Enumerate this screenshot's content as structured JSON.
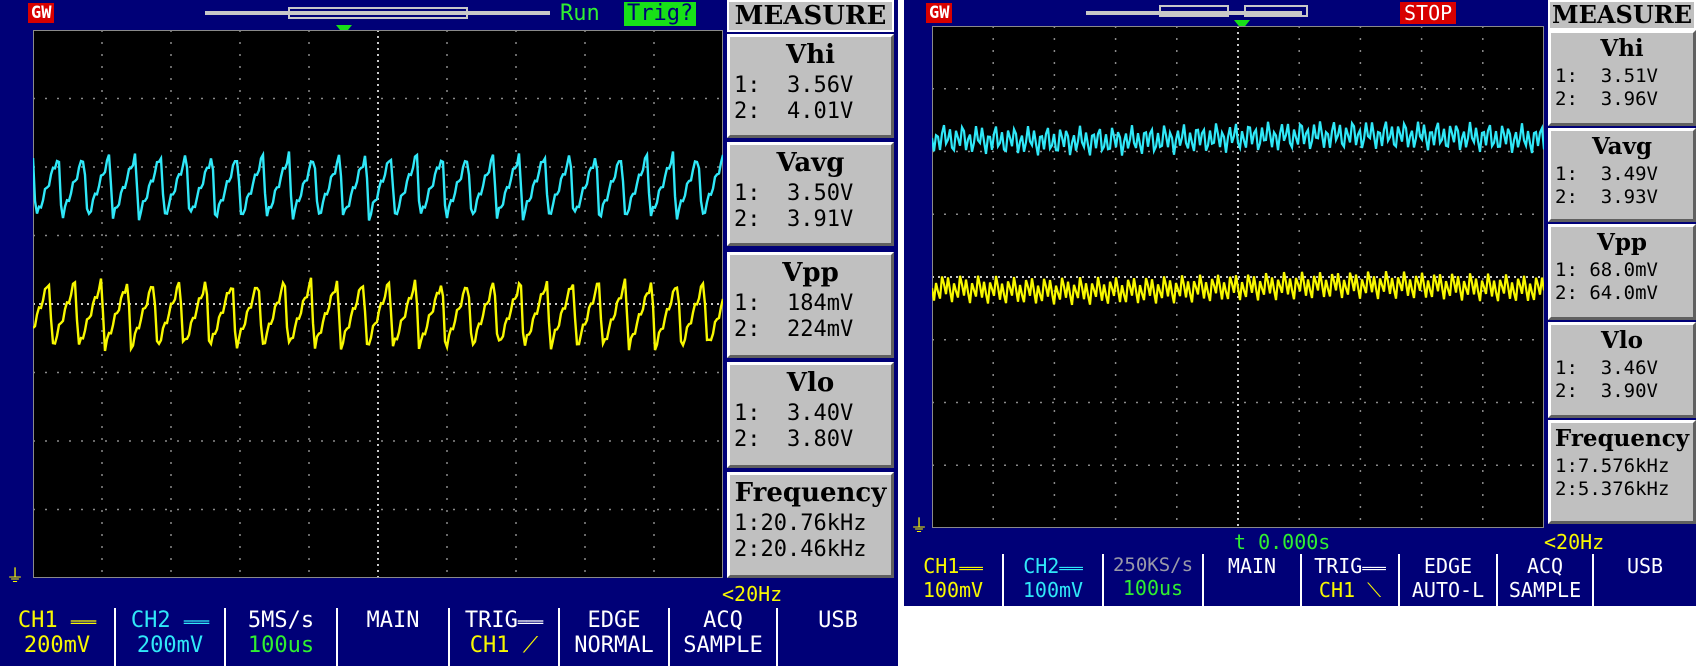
{
  "left_scope": {
    "badge": "GW",
    "run_label": "Run",
    "trig_status": "Trig?",
    "measure_title": "MEASURE",
    "measurements": [
      {
        "name": "Vhi",
        "ch1": "1:  3.56V",
        "ch2": "2:  4.01V"
      },
      {
        "name": "Vavg",
        "ch1": "1:  3.50V",
        "ch2": "2:  3.91V"
      },
      {
        "name": "Vpp",
        "ch1": "1:  184mV",
        "ch2": "2:  224mV"
      },
      {
        "name": "Vlo",
        "ch1": "1:  3.40V",
        "ch2": "2:  3.80V"
      },
      {
        "name": "Frequency",
        "ch1": "1:20.76kHz",
        "ch2": "2:20.46kHz"
      }
    ],
    "freq_status": "<20Hz",
    "bottom": {
      "ch1": {
        "label": "CH1",
        "value": "200mV"
      },
      "ch2": {
        "label": "CH2",
        "value": "200mV"
      },
      "rate": {
        "label": "5MS/s",
        "value": "100us"
      },
      "main": "MAIN",
      "trig": {
        "label": "TRIG",
        "value": "CH1"
      },
      "edge": {
        "label": "EDGE",
        "value": "NORMAL"
      },
      "acq": {
        "label": "ACQ",
        "value": "SAMPLE"
      },
      "usb": "USB"
    }
  },
  "right_scope": {
    "badge": "GW",
    "stop_label": "STOP",
    "measure_title": "MEASURE",
    "measurements": [
      {
        "name": "Vhi",
        "ch1": "1:  3.51V",
        "ch2": "2:  3.96V"
      },
      {
        "name": "Vavg",
        "ch1": "1:  3.49V",
        "ch2": "2:  3.93V"
      },
      {
        "name": "Vpp",
        "ch1": "1: 68.0mV",
        "ch2": "2: 64.0mV"
      },
      {
        "name": "Vlo",
        "ch1": "1:  3.46V",
        "ch2": "2:  3.90V"
      },
      {
        "name": "Frequency",
        "ch1": "1:7.576kHz",
        "ch2": "2:5.376kHz"
      }
    ],
    "time_readout": "t 0.000s",
    "freq_status": "<20Hz",
    "bottom": {
      "ch1": {
        "label": "CH1",
        "value": "100mV"
      },
      "ch2": {
        "label": "CH2",
        "value": "100mV"
      },
      "rate": {
        "label": "250KS/s",
        "value": "100us"
      },
      "main": "MAIN",
      "trig": {
        "label": "TRIG",
        "value": "CH1"
      },
      "edge": {
        "label": "EDGE",
        "value": "AUTO-L"
      },
      "acq": {
        "label": "ACQ",
        "value": "SAMPLE"
      },
      "usb": "USB"
    }
  },
  "colors": {
    "background": "#000077",
    "ch1_trace": "#30e8f8",
    "ch2_trace": "#f8f800",
    "status_green": "#18e018",
    "status_red": "#d80000"
  }
}
